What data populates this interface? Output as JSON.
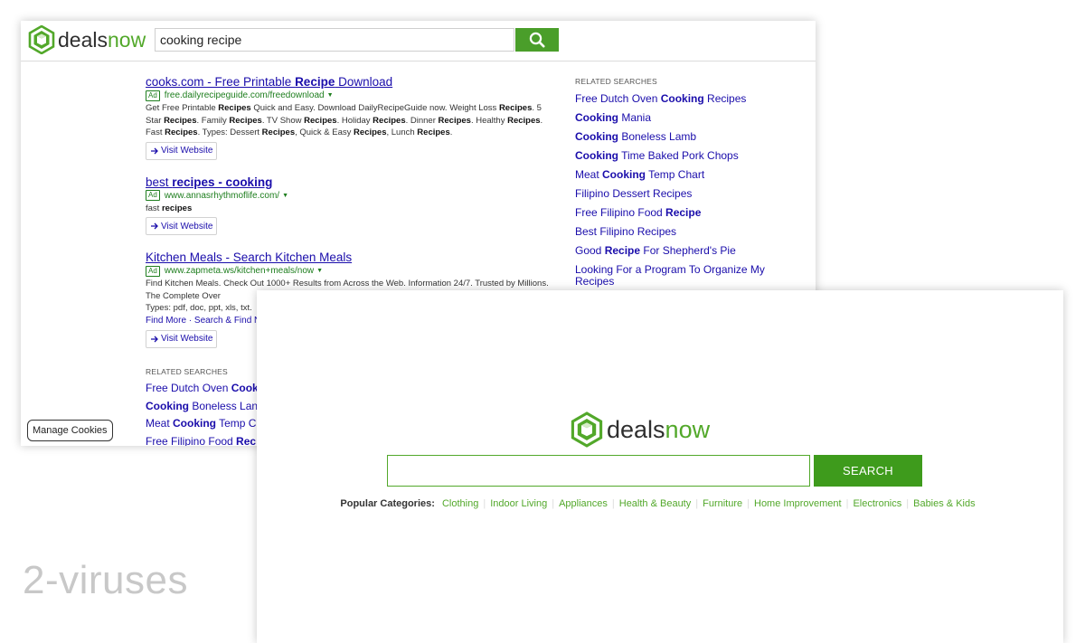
{
  "brand": {
    "part1": "deals",
    "part2": "now",
    "accent_color": "#52a82a",
    "dark_color": "#2f2f2f"
  },
  "results_page": {
    "search_query": "cooking recipe",
    "search_icon": "magnifier-icon",
    "results": [
      {
        "title_parts": [
          {
            "t": "cooks.com - Free Printable ",
            "b": false
          },
          {
            "t": "Recipe",
            "b": true
          },
          {
            "t": " Download",
            "b": false
          }
        ],
        "ad_label": "Ad",
        "url": "free.dailyrecipeguide.com/freedownload",
        "description_html": "Get Free Printable <b>Recipes</b> Quick and Easy. Download DailyRecipeGuide now. Weight Loss <b>Recipes</b>. 5 Star <b>Recipes</b>. Family <b>Recipes</b>. TV Show <b>Recipes</b>. Holiday <b>Recipes</b>. Dinner <b>Recipes</b>. Healthy <b>Recipes</b>. Fast <b>Recipes</b>. Types: Dessert <b>Recipes</b>, Quick &amp; Easy <b>Recipes</b>, Lunch <b>Recipes</b>.",
        "visit_label": "Visit Website"
      },
      {
        "title_parts": [
          {
            "t": "best ",
            "b": false
          },
          {
            "t": "recipes - cooking",
            "b": true
          }
        ],
        "ad_label": "Ad",
        "url": "www.annasrhythmoflife.com/",
        "description_html": "fast <b>recipes</b>",
        "visit_label": "Visit Website"
      },
      {
        "title_parts": [
          {
            "t": "Kitchen Meals - Search Kitchen Meals",
            "b": false
          }
        ],
        "ad_label": "Ad",
        "url": "www.zapmeta.ws/kitchen+meals/now",
        "description_html": "Find Kitchen Meals. Check Out 1000+ Results from Across the Web. Information 24/7. Trusted by Millions. The Complete Over",
        "description_line3": "Types: pdf, doc, ppt, xls, txt.",
        "find_more": "Find More · Search & Find N",
        "visit_label": "Visit Website"
      }
    ],
    "related_label": "RELATED SEARCHES",
    "related_right": [
      [
        {
          "t": "Free Dutch Oven ",
          "b": false
        },
        {
          "t": "Cooking",
          "b": true
        },
        {
          "t": " Recipes",
          "b": false
        }
      ],
      [
        {
          "t": "Cooking",
          "b": true
        },
        {
          "t": " Mania",
          "b": false
        }
      ],
      [
        {
          "t": "Cooking",
          "b": true
        },
        {
          "t": " Boneless Lamb",
          "b": false
        }
      ],
      [
        {
          "t": "Cooking",
          "b": true
        },
        {
          "t": " Time Baked Pork Chops",
          "b": false
        }
      ],
      [
        {
          "t": "Meat ",
          "b": false
        },
        {
          "t": "Cooking",
          "b": true
        },
        {
          "t": " Temp Chart",
          "b": false
        }
      ],
      [
        {
          "t": "Filipino Dessert Recipes",
          "b": false
        }
      ],
      [
        {
          "t": "Free Filipino Food ",
          "b": false
        },
        {
          "t": "Recipe",
          "b": true
        }
      ],
      [
        {
          "t": "Best Filipino Recipes",
          "b": false
        }
      ],
      [
        {
          "t": "Good ",
          "b": false
        },
        {
          "t": "Recipe",
          "b": true
        },
        {
          "t": " For Shepherd's Pie",
          "b": false
        }
      ],
      [
        {
          "t": "Looking For a Program To Organize My Recipes",
          "b": false
        }
      ]
    ],
    "related_bottom": [
      [
        {
          "t": "Free Dutch Oven ",
          "b": false
        },
        {
          "t": "Cook",
          "b": true
        }
      ],
      [
        {
          "t": "Cooking",
          "b": true
        },
        {
          "t": " Boneless Lan",
          "b": false
        }
      ],
      [
        {
          "t": "Meat ",
          "b": false
        },
        {
          "t": "Cooking",
          "b": true
        },
        {
          "t": " Temp C",
          "b": false
        }
      ],
      [
        {
          "t": "Free Filipino Food ",
          "b": false
        },
        {
          "t": "Rec",
          "b": true
        }
      ]
    ],
    "manage_cookies_label": "Manage Cookies"
  },
  "home_page": {
    "search_value": "",
    "search_button_label": "SEARCH",
    "categories_label": "Popular Categories:",
    "categories": [
      "Clothing",
      "Indoor Living",
      "Appliances",
      "Health & Beauty",
      "Furniture",
      "Home Improvement",
      "Electronics",
      "Babies & Kids"
    ]
  },
  "watermark": "2-viruses"
}
